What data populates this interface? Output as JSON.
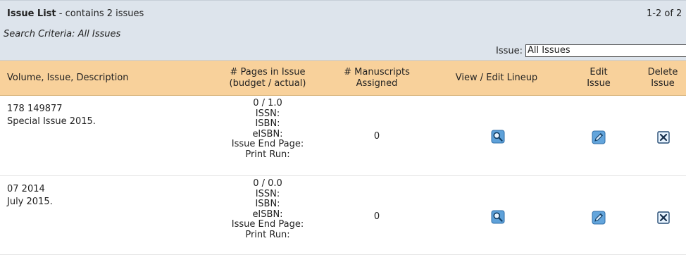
{
  "header": {
    "title": "Issue List",
    "subtitle": " - contains 2 issues",
    "range": "1-2 of 2",
    "search_criteria": "Search Criteria: All Issues"
  },
  "filter": {
    "label": "Issue:",
    "selected": "All Issues",
    "arrow": "⌄"
  },
  "columns": {
    "description": "Volume, Issue, Description",
    "pages_line1": "# Pages in Issue",
    "pages_line2": "(budget / actual)",
    "manuscripts_line1": "# Manuscripts",
    "manuscripts_line2": "Assigned",
    "lineup": "View / Edit Lineup",
    "edit_line1": "Edit",
    "edit_line2": "Issue",
    "delete_line1": "Delete",
    "delete_line2": "Issue"
  },
  "rows": [
    {
      "volume_issue": "178 149877",
      "description": "Special Issue 2015.",
      "pages": "0 / 1.0",
      "issn": "ISSN:",
      "isbn": "ISBN:",
      "eisbn": "eISBN:",
      "end_page": "Issue End Page:",
      "print_run": "Print Run:",
      "manuscripts": "0",
      "icons": {
        "lineup": "magnifier-icon",
        "edit": "pencil-icon",
        "delete": "close-icon"
      }
    },
    {
      "volume_issue": "07 2014",
      "description": "July 2015.",
      "pages": "0 / 0.0",
      "issn": "ISSN:",
      "isbn": "ISBN:",
      "eisbn": "eISBN:",
      "end_page": "Issue End Page:",
      "print_run": "Print Run:",
      "manuscripts": "0",
      "icons": {
        "lineup": "magnifier-icon",
        "edit": "pencil-icon",
        "delete": "close-icon"
      }
    }
  ],
  "colors": {
    "header_bg": "#dde4ec",
    "column_header_bg": "#f8d19b",
    "icon_blue": "#4f8fc9",
    "delete_blue": "#2d4f7a"
  }
}
